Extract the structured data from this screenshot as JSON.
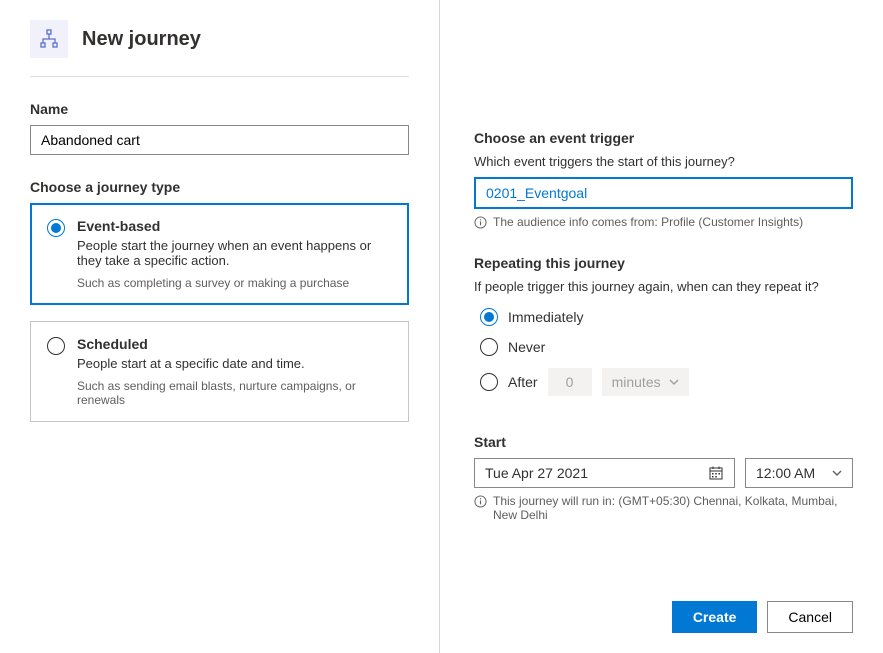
{
  "header": {
    "title": "New journey"
  },
  "left": {
    "name_label": "Name",
    "name_value": "Abandoned cart",
    "journey_type_label": "Choose a journey type",
    "types": [
      {
        "title": "Event-based",
        "desc": "People start the journey when an event happens or they take a specific action.",
        "hint": "Such as completing a survey or making a purchase",
        "selected": true
      },
      {
        "title": "Scheduled",
        "desc": "People start at a specific date and time.",
        "hint": "Such as sending email blasts, nurture campaigns, or renewals",
        "selected": false
      }
    ]
  },
  "right": {
    "trigger_heading": "Choose an event trigger",
    "trigger_sublabel": "Which event triggers the start of this journey?",
    "trigger_value": "0201_Eventgoal",
    "trigger_info": "The audience info comes from: Profile (Customer Insights)",
    "repeat_heading": "Repeating this journey",
    "repeat_sublabel": "If people trigger this journey again, when can they repeat it?",
    "repeat_options": {
      "immediately": "Immediately",
      "never": "Never",
      "after": "After",
      "after_value": "0",
      "after_unit": "minutes"
    },
    "start_heading": "Start",
    "start_date": "Tue Apr 27 2021",
    "start_time": "12:00 AM",
    "timezone_info": "This journey will run in: (GMT+05:30) Chennai, Kolkata, Mumbai, New Delhi"
  },
  "footer": {
    "create": "Create",
    "cancel": "Cancel"
  }
}
